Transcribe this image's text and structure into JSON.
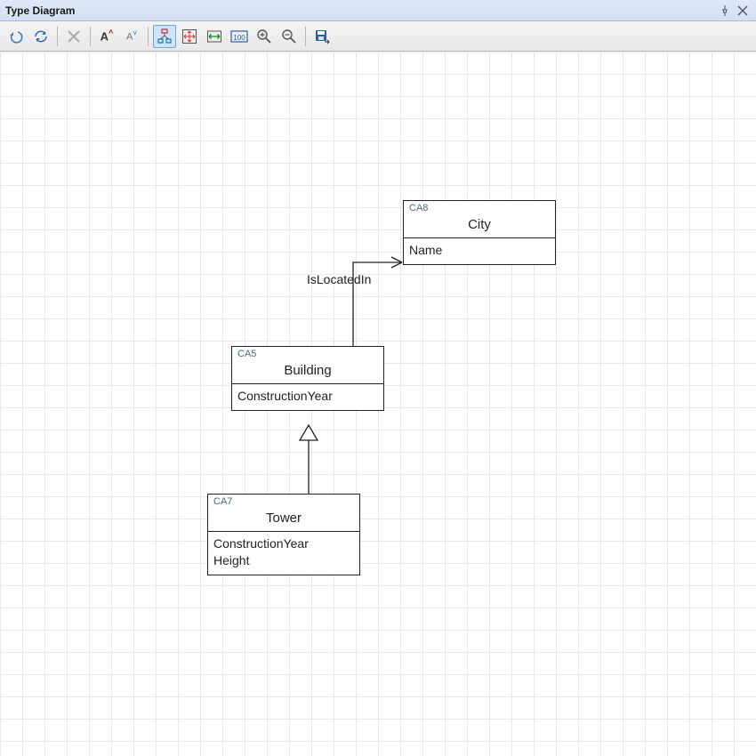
{
  "window": {
    "title": "Type Diagram"
  },
  "toolbar": {
    "btn_undo": "undo",
    "btn_refresh": "refresh",
    "btn_delete": "delete",
    "btn_font_inc": "A^",
    "btn_font_dec": "A˅",
    "btn_layout": "layout",
    "btn_fit_page": "fit-page",
    "btn_fit_width": "fit-width",
    "btn_zoom_100": "100",
    "btn_zoom_in": "zoom-in",
    "btn_zoom_out": "zoom-out",
    "btn_save": "save"
  },
  "entities": {
    "city": {
      "id": "CA8",
      "name": "City",
      "attrs": [
        "Name"
      ]
    },
    "bld": {
      "id": "CA5",
      "name": "Building",
      "attrs": [
        "ConstructionYear"
      ]
    },
    "tower": {
      "id": "CA7",
      "name": "Tower",
      "attrs": [
        "ConstructionYear",
        "Height"
      ]
    }
  },
  "rel": {
    "isLocatedIn": "IsLocatedIn"
  }
}
